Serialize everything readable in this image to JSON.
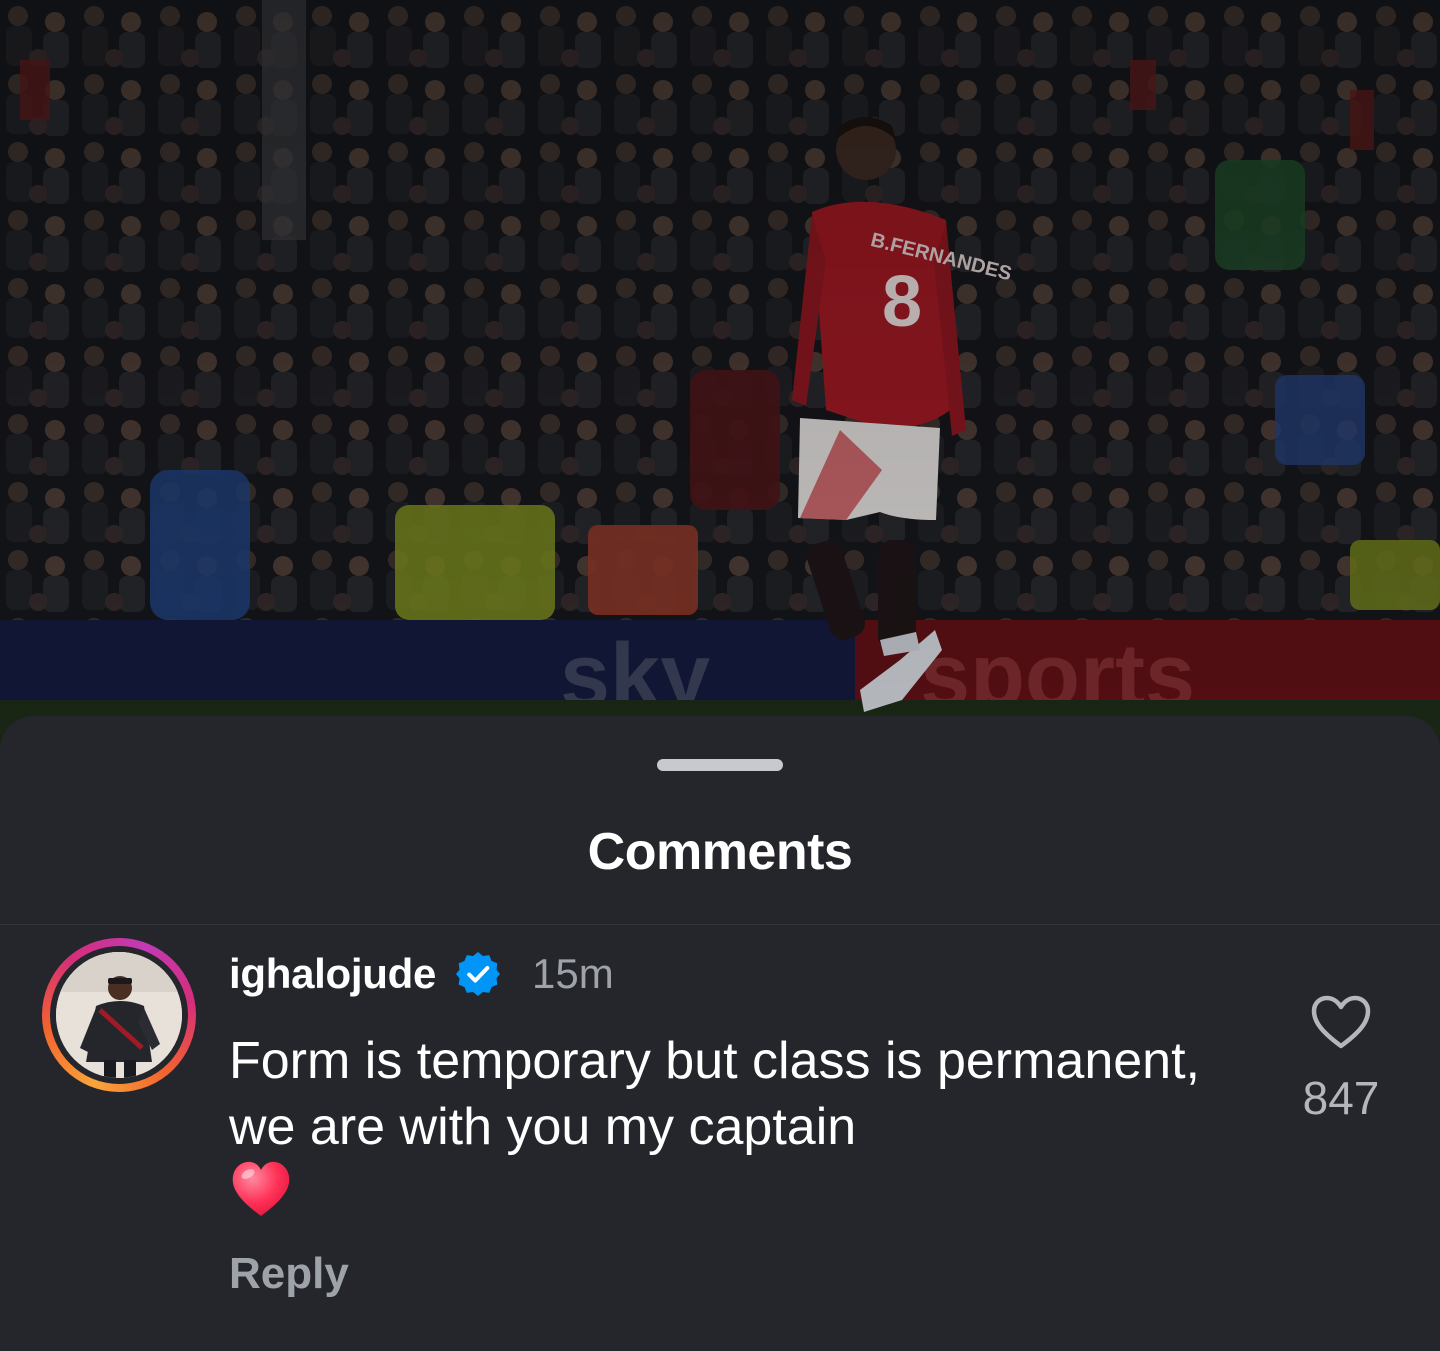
{
  "background_post": {
    "image_subject": "football-player-walking-stadium",
    "jersey_name": "B.FERNANDES",
    "jersey_number": "8",
    "board_text": "sky sports"
  },
  "comments_sheet": {
    "title": "Comments"
  },
  "comment": {
    "username": "ighalojude",
    "verified_icon": "verified-badge-icon",
    "timestamp": "15m",
    "text": "Form is temporary but class is permanent, we are with you my captain",
    "emoji": "red-heart-icon",
    "reply_label": "Reply",
    "like_icon": "heart-outline-icon",
    "like_count": "847"
  },
  "colors": {
    "sheet_background": "#24262b",
    "text_primary": "#ffffff",
    "text_secondary": "#9ea2a9",
    "verified_blue": "#0095f6",
    "story_ring_start": "#f9a53a",
    "story_ring_end": "#c13ab6",
    "heart_red": "#ff2d55"
  }
}
